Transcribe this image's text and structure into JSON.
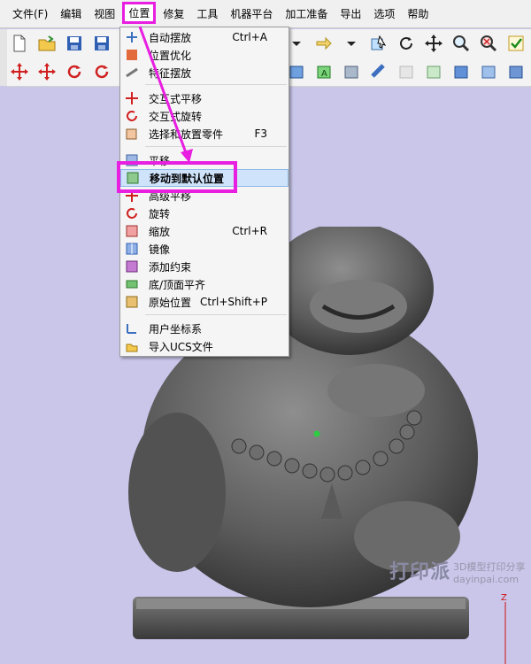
{
  "menubar": {
    "items": [
      "文件(F)",
      "编辑",
      "视图",
      "位置",
      "修复",
      "工具",
      "机器平台",
      "加工准备",
      "导出",
      "选项",
      "帮助"
    ]
  },
  "dropdown": {
    "items": [
      {
        "label": "自动摆放",
        "shortcut": "Ctrl+A",
        "icon": "auto-place-icon"
      },
      {
        "label": "位置优化",
        "shortcut": "",
        "icon": "optimize-position-icon"
      },
      {
        "label": "特征摆放",
        "shortcut": "",
        "icon": "feature-place-icon"
      },
      {
        "label": "交互式平移",
        "shortcut": "",
        "icon": "interactive-translate-icon"
      },
      {
        "label": "交互式旋转",
        "shortcut": "",
        "icon": "interactive-rotate-icon"
      },
      {
        "label": "选择和放置零件",
        "shortcut": "F3",
        "icon": "select-place-icon"
      },
      {
        "label": "平移",
        "shortcut": "",
        "icon": "translate-icon"
      },
      {
        "label": "移动到默认位置",
        "shortcut": "",
        "icon": "move-default-icon"
      },
      {
        "label": "高级平移",
        "shortcut": "",
        "icon": "advanced-translate-icon"
      },
      {
        "label": "旋转",
        "shortcut": "",
        "icon": "rotate-icon"
      },
      {
        "label": "缩放",
        "shortcut": "Ctrl+R",
        "icon": "scale-icon"
      },
      {
        "label": "镜像",
        "shortcut": "",
        "icon": "mirror-icon"
      },
      {
        "label": "添加约束",
        "shortcut": "",
        "icon": "constraint-icon"
      },
      {
        "label": "底/顶面平齐",
        "shortcut": "",
        "icon": "align-bottom-top-icon"
      },
      {
        "label": "原始位置",
        "shortcut": "Ctrl+Shift+P",
        "icon": "original-position-icon"
      },
      {
        "label": "用户坐标系",
        "shortcut": "",
        "icon": "ucs-icon"
      },
      {
        "label": "导入UCS文件",
        "shortcut": "",
        "icon": "import-ucs-icon"
      }
    ]
  },
  "viewport": {
    "axis_label": "Z",
    "watermark_main": "打印派",
    "watermark_sub1": "3D模型打印分享",
    "watermark_sub2": "dayinpai.com"
  },
  "colors": {
    "highlight_magenta": "#e81ee0",
    "viewport_bg": "#c9c6ea",
    "menu_bg": "#f5f5f5"
  }
}
